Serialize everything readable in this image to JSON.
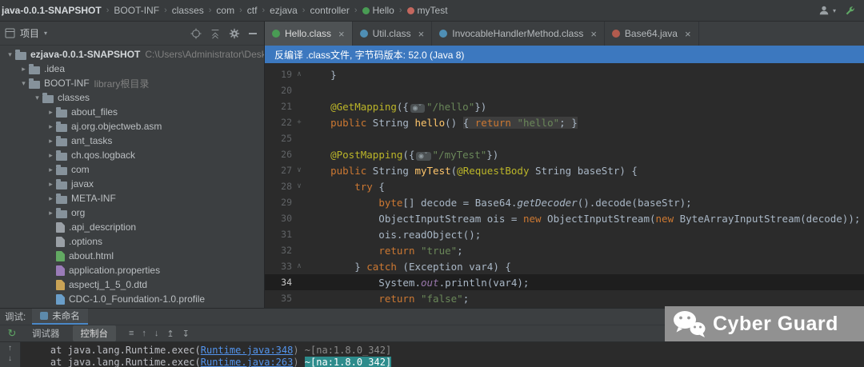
{
  "breadcrumbs": {
    "items": [
      {
        "label": "java-0.0.1-SNAPSHOT",
        "bold": true
      },
      {
        "label": "BOOT-INF"
      },
      {
        "label": "classes"
      },
      {
        "label": "com"
      },
      {
        "label": "ctf"
      },
      {
        "label": "ezjava"
      },
      {
        "label": "controller"
      },
      {
        "label": "Hello",
        "icon": "class-green"
      },
      {
        "label": "myTest",
        "icon": "method-pink"
      }
    ]
  },
  "project_panel": {
    "title": "项目",
    "tree": [
      {
        "label": "ezjava-0.0.1-SNAPSHOT",
        "suffix": "C:\\Users\\Administrator\\Desktop",
        "depth": 0,
        "chevron": "open",
        "icon": "folder",
        "bold": true
      },
      {
        "label": ".idea",
        "depth": 1,
        "chevron": "closed",
        "icon": "folder"
      },
      {
        "label": "BOOT-INF",
        "suffix": "library根目录",
        "depth": 1,
        "chevron": "open",
        "icon": "folder"
      },
      {
        "label": "classes",
        "depth": 2,
        "chevron": "open",
        "icon": "folder"
      },
      {
        "label": "about_files",
        "depth": 3,
        "chevron": "closed",
        "icon": "folder"
      },
      {
        "label": "aj.org.objectweb.asm",
        "depth": 3,
        "chevron": "closed",
        "icon": "folder"
      },
      {
        "label": "ant_tasks",
        "depth": 3,
        "chevron": "closed",
        "icon": "folder"
      },
      {
        "label": "ch.qos.logback",
        "depth": 3,
        "chevron": "closed",
        "icon": "folder"
      },
      {
        "label": "com",
        "depth": 3,
        "chevron": "closed",
        "icon": "folder"
      },
      {
        "label": "javax",
        "depth": 3,
        "chevron": "closed",
        "icon": "folder"
      },
      {
        "label": "META-INF",
        "depth": 3,
        "chevron": "closed",
        "icon": "folder"
      },
      {
        "label": "org",
        "depth": 3,
        "chevron": "closed",
        "icon": "folder"
      },
      {
        "label": ".api_description",
        "depth": 3,
        "icon": "file-gray"
      },
      {
        "label": ".options",
        "depth": 3,
        "icon": "file-gray"
      },
      {
        "label": "about.html",
        "depth": 3,
        "icon": "file-green"
      },
      {
        "label": "application.properties",
        "depth": 3,
        "icon": "file-purple"
      },
      {
        "label": "aspectj_1_5_0.dtd",
        "depth": 3,
        "icon": "file-yellow"
      },
      {
        "label": "CDC-1.0_Foundation-1.0.profile",
        "depth": 3,
        "icon": "file-blue"
      }
    ]
  },
  "editor_tabs": [
    {
      "label": "Hello.class",
      "icon": "class-green",
      "selected": true
    },
    {
      "label": "Util.class",
      "icon": "class-blue",
      "selected": false
    },
    {
      "label": "InvocableHandlerMethod.class",
      "icon": "class-blue",
      "selected": false
    },
    {
      "label": "Base64.java",
      "icon": "java-file",
      "selected": false
    }
  ],
  "banner": {
    "text": "反编译 .class文件, 字节码版本: 52.0 (Java 8)"
  },
  "editor": {
    "lines": [
      {
        "num": "19",
        "fold": "∧",
        "segments": [
          {
            "t": "    }",
            "c": "pln"
          }
        ]
      },
      {
        "num": "20",
        "segments": []
      },
      {
        "num": "21",
        "segments": [
          {
            "t": "    ",
            "c": "pln"
          },
          {
            "t": "@GetMapping",
            "c": "ann"
          },
          {
            "t": "({",
            "c": "pln"
          },
          {
            "t": "◉ˇ",
            "c": "inlay"
          },
          {
            "t": "\"/hello\"",
            "c": "str"
          },
          {
            "t": "})",
            "c": "pln"
          }
        ]
      },
      {
        "num": "22",
        "fold": "+",
        "segments": [
          {
            "t": "    ",
            "c": "pln"
          },
          {
            "t": "public",
            "c": "kw"
          },
          {
            "t": " String ",
            "c": "pln"
          },
          {
            "t": "hello",
            "c": "mth"
          },
          {
            "t": "() ",
            "c": "pln"
          },
          {
            "t": "{ ",
            "c": "pln fold"
          },
          {
            "t": "return ",
            "c": "kw fold"
          },
          {
            "t": "\"hello\"",
            "c": "str fold"
          },
          {
            "t": "; }",
            "c": "pln fold"
          }
        ]
      },
      {
        "num": "25",
        "segments": []
      },
      {
        "num": "26",
        "segments": [
          {
            "t": "    ",
            "c": "pln"
          },
          {
            "t": "@PostMapping",
            "c": "ann"
          },
          {
            "t": "({",
            "c": "pln"
          },
          {
            "t": "◉ˇ",
            "c": "inlay"
          },
          {
            "t": "\"/myTest\"",
            "c": "str"
          },
          {
            "t": "})",
            "c": "pln"
          }
        ]
      },
      {
        "num": "27",
        "fold": "∨",
        "segments": [
          {
            "t": "    ",
            "c": "pln"
          },
          {
            "t": "public",
            "c": "kw"
          },
          {
            "t": " String ",
            "c": "pln"
          },
          {
            "t": "myTest",
            "c": "mth"
          },
          {
            "t": "(",
            "c": "pln"
          },
          {
            "t": "@RequestBody",
            "c": "ann"
          },
          {
            "t": " String baseStr) {",
            "c": "pln"
          }
        ]
      },
      {
        "num": "28",
        "fold": "∨",
        "segments": [
          {
            "t": "        ",
            "c": "pln"
          },
          {
            "t": "try",
            "c": "kw"
          },
          {
            "t": " {",
            "c": "pln"
          }
        ]
      },
      {
        "num": "29",
        "segments": [
          {
            "t": "            ",
            "c": "pln"
          },
          {
            "t": "byte",
            "c": "kw"
          },
          {
            "t": "[] decode = Base64.",
            "c": "pln"
          },
          {
            "t": "getDecoder",
            "c": "stc"
          },
          {
            "t": "().decode(baseStr);",
            "c": "pln"
          }
        ]
      },
      {
        "num": "30",
        "segments": [
          {
            "t": "            ObjectInputStream ois = ",
            "c": "pln"
          },
          {
            "t": "new",
            "c": "kw"
          },
          {
            "t": " ObjectInputStream(",
            "c": "pln"
          },
          {
            "t": "new",
            "c": "kw"
          },
          {
            "t": " ByteArrayInputStream(decode));",
            "c": "pln"
          }
        ]
      },
      {
        "num": "31",
        "segments": [
          {
            "t": "            ois.readObject();",
            "c": "pln"
          }
        ]
      },
      {
        "num": "32",
        "segments": [
          {
            "t": "            ",
            "c": "pln"
          },
          {
            "t": "return ",
            "c": "kw"
          },
          {
            "t": "\"true\"",
            "c": "str"
          },
          {
            "t": ";",
            "c": "pln"
          }
        ]
      },
      {
        "num": "33",
        "fold": "∧",
        "segments": [
          {
            "t": "        } ",
            "c": "pln"
          },
          {
            "t": "catch",
            "c": "kw"
          },
          {
            "t": " (Exception var4) {",
            "c": "pln"
          }
        ]
      },
      {
        "num": "34",
        "highlight": true,
        "segments": [
          {
            "t": "            System.",
            "c": "pln"
          },
          {
            "t": "out",
            "c": "fld"
          },
          {
            "t": ".println(var4);",
            "c": "pln"
          }
        ]
      },
      {
        "num": "35",
        "segments": [
          {
            "t": "            ",
            "c": "pln"
          },
          {
            "t": "return ",
            "c": "kw"
          },
          {
            "t": "\"false\"",
            "c": "str"
          },
          {
            "t": ";",
            "c": "pln"
          }
        ]
      }
    ]
  },
  "debug_panel": {
    "title": "调试:",
    "session_tab": {
      "label": "未命名"
    },
    "tabs": [
      {
        "label": "调试器",
        "selected": false
      },
      {
        "label": "控制台",
        "selected": true
      }
    ]
  },
  "console": {
    "lines": [
      {
        "segments": [
          {
            "t": "    at java.lang.Runtime.exec(",
            "c": "cpl"
          },
          {
            "t": "Runtime.java:348",
            "c": "clink"
          },
          {
            "t": ") ~[na:1.8.0_342]",
            "c": "cdim"
          }
        ]
      },
      {
        "segments": [
          {
            "t": "    at java.lang.Runtime.exec(",
            "c": "cpl"
          },
          {
            "t": "Runtime.java:263",
            "c": "clink"
          },
          {
            "t": ") ",
            "c": "cdim"
          },
          {
            "t": "~[na:1.8.0_342]",
            "c": "csel"
          }
        ]
      }
    ]
  },
  "watermark": {
    "text": "Cyber Guard"
  }
}
